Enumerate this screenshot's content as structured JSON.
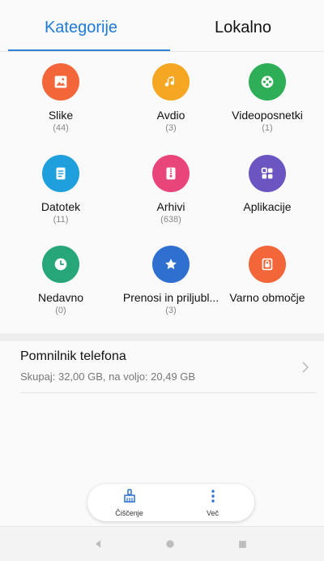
{
  "tabs": [
    {
      "label": "Kategorije",
      "active": true
    },
    {
      "label": "Lokalno",
      "active": false
    }
  ],
  "categories": [
    {
      "label": "Slike",
      "count": "(44)",
      "color": "#f2663a",
      "icon": "image-icon"
    },
    {
      "label": "Avdio",
      "count": "(3)",
      "color": "#f5a623",
      "icon": "music-note-icon"
    },
    {
      "label": "Videoposnetki",
      "count": "(1)",
      "color": "#2eaf57",
      "icon": "film-reel-icon"
    },
    {
      "label": "Datotek",
      "count": "(11)",
      "color": "#1f9fdc",
      "icon": "document-icon"
    },
    {
      "label": "Arhivi",
      "count": "(638)",
      "color": "#e8457b",
      "icon": "archive-zip-icon"
    },
    {
      "label": "Aplikacije",
      "count": "",
      "color": "#6b55c0",
      "icon": "apps-grid-icon"
    },
    {
      "label": "Nedavno",
      "count": "(0)",
      "color": "#27a779",
      "icon": "clock-icon"
    },
    {
      "label": "Prenosi in priljubl...",
      "count": "(3)",
      "color": "#2f6fd0",
      "icon": "star-icon"
    },
    {
      "label": "Varno območje",
      "count": "",
      "color": "#f2663a",
      "icon": "safe-lock-icon"
    }
  ],
  "storage": {
    "title": "Pomnilnik telefona",
    "subtitle": "Skupaj: 32,00 GB, na voljo: 20,49 GB",
    "icon": "chevron-right-icon"
  },
  "actions": [
    {
      "label": "Čiščenje",
      "icon": "broom-icon",
      "color": "#2b6fd6"
    },
    {
      "label": "Več",
      "icon": "more-vertical-icon",
      "color": "#2b6fd6"
    }
  ],
  "nav": {
    "back_icon": "back-triangle-icon",
    "home_icon": "home-circle-icon",
    "recents_icon": "recents-square-icon"
  },
  "colors": {
    "accent": "#1e7ad6",
    "background": "#fafafa"
  }
}
